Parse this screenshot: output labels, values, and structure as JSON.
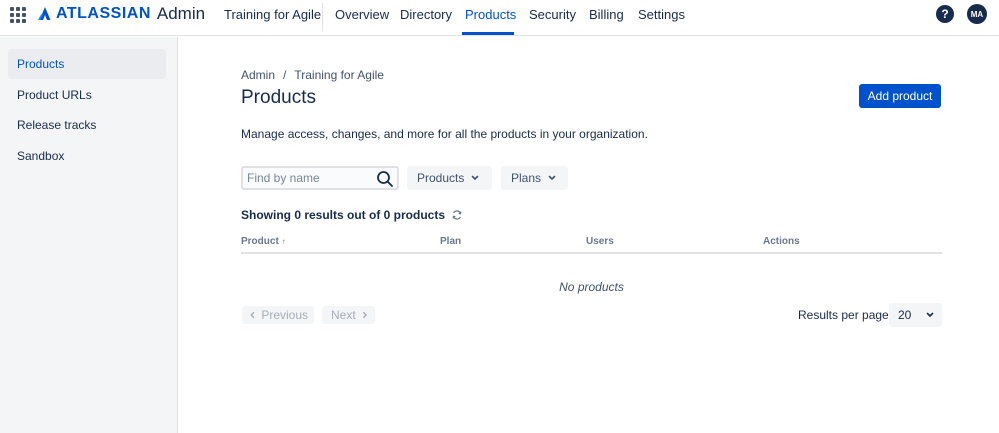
{
  "topnav": {
    "brand": "ATLASSIAN",
    "product": "Admin",
    "org": "Training for Agile",
    "tabs": [
      {
        "label": "Overview"
      },
      {
        "label": "Directory"
      },
      {
        "label": "Products"
      },
      {
        "label": "Security"
      },
      {
        "label": "Billing"
      },
      {
        "label": "Settings"
      }
    ],
    "help": "?",
    "avatar_initials": "MA",
    "accent_color": "#0052cc"
  },
  "sidebar": {
    "items": [
      {
        "label": "Products"
      },
      {
        "label": "Product URLs"
      },
      {
        "label": "Release tracks"
      },
      {
        "label": "Sandbox"
      }
    ]
  },
  "main": {
    "breadcrumb": [
      "Admin",
      "/",
      "Training for Agile"
    ],
    "title": "Products",
    "add_button": "Add product",
    "description": "Manage access, changes, and more for all the products in your organization.",
    "search_placeholder": "Find by name",
    "filters": [
      {
        "label": "Products"
      },
      {
        "label": "Plans"
      }
    ],
    "results_text": "Showing 0 results out of 0 products",
    "columns": [
      "Product",
      "Plan",
      "Users",
      "Actions"
    ],
    "sort_indicator": "↑",
    "empty_text": "No products",
    "pagination": {
      "previous": "Previous",
      "next": "Next",
      "results_per_page_label": "Results per page:",
      "results_per_page_value": "20"
    }
  }
}
